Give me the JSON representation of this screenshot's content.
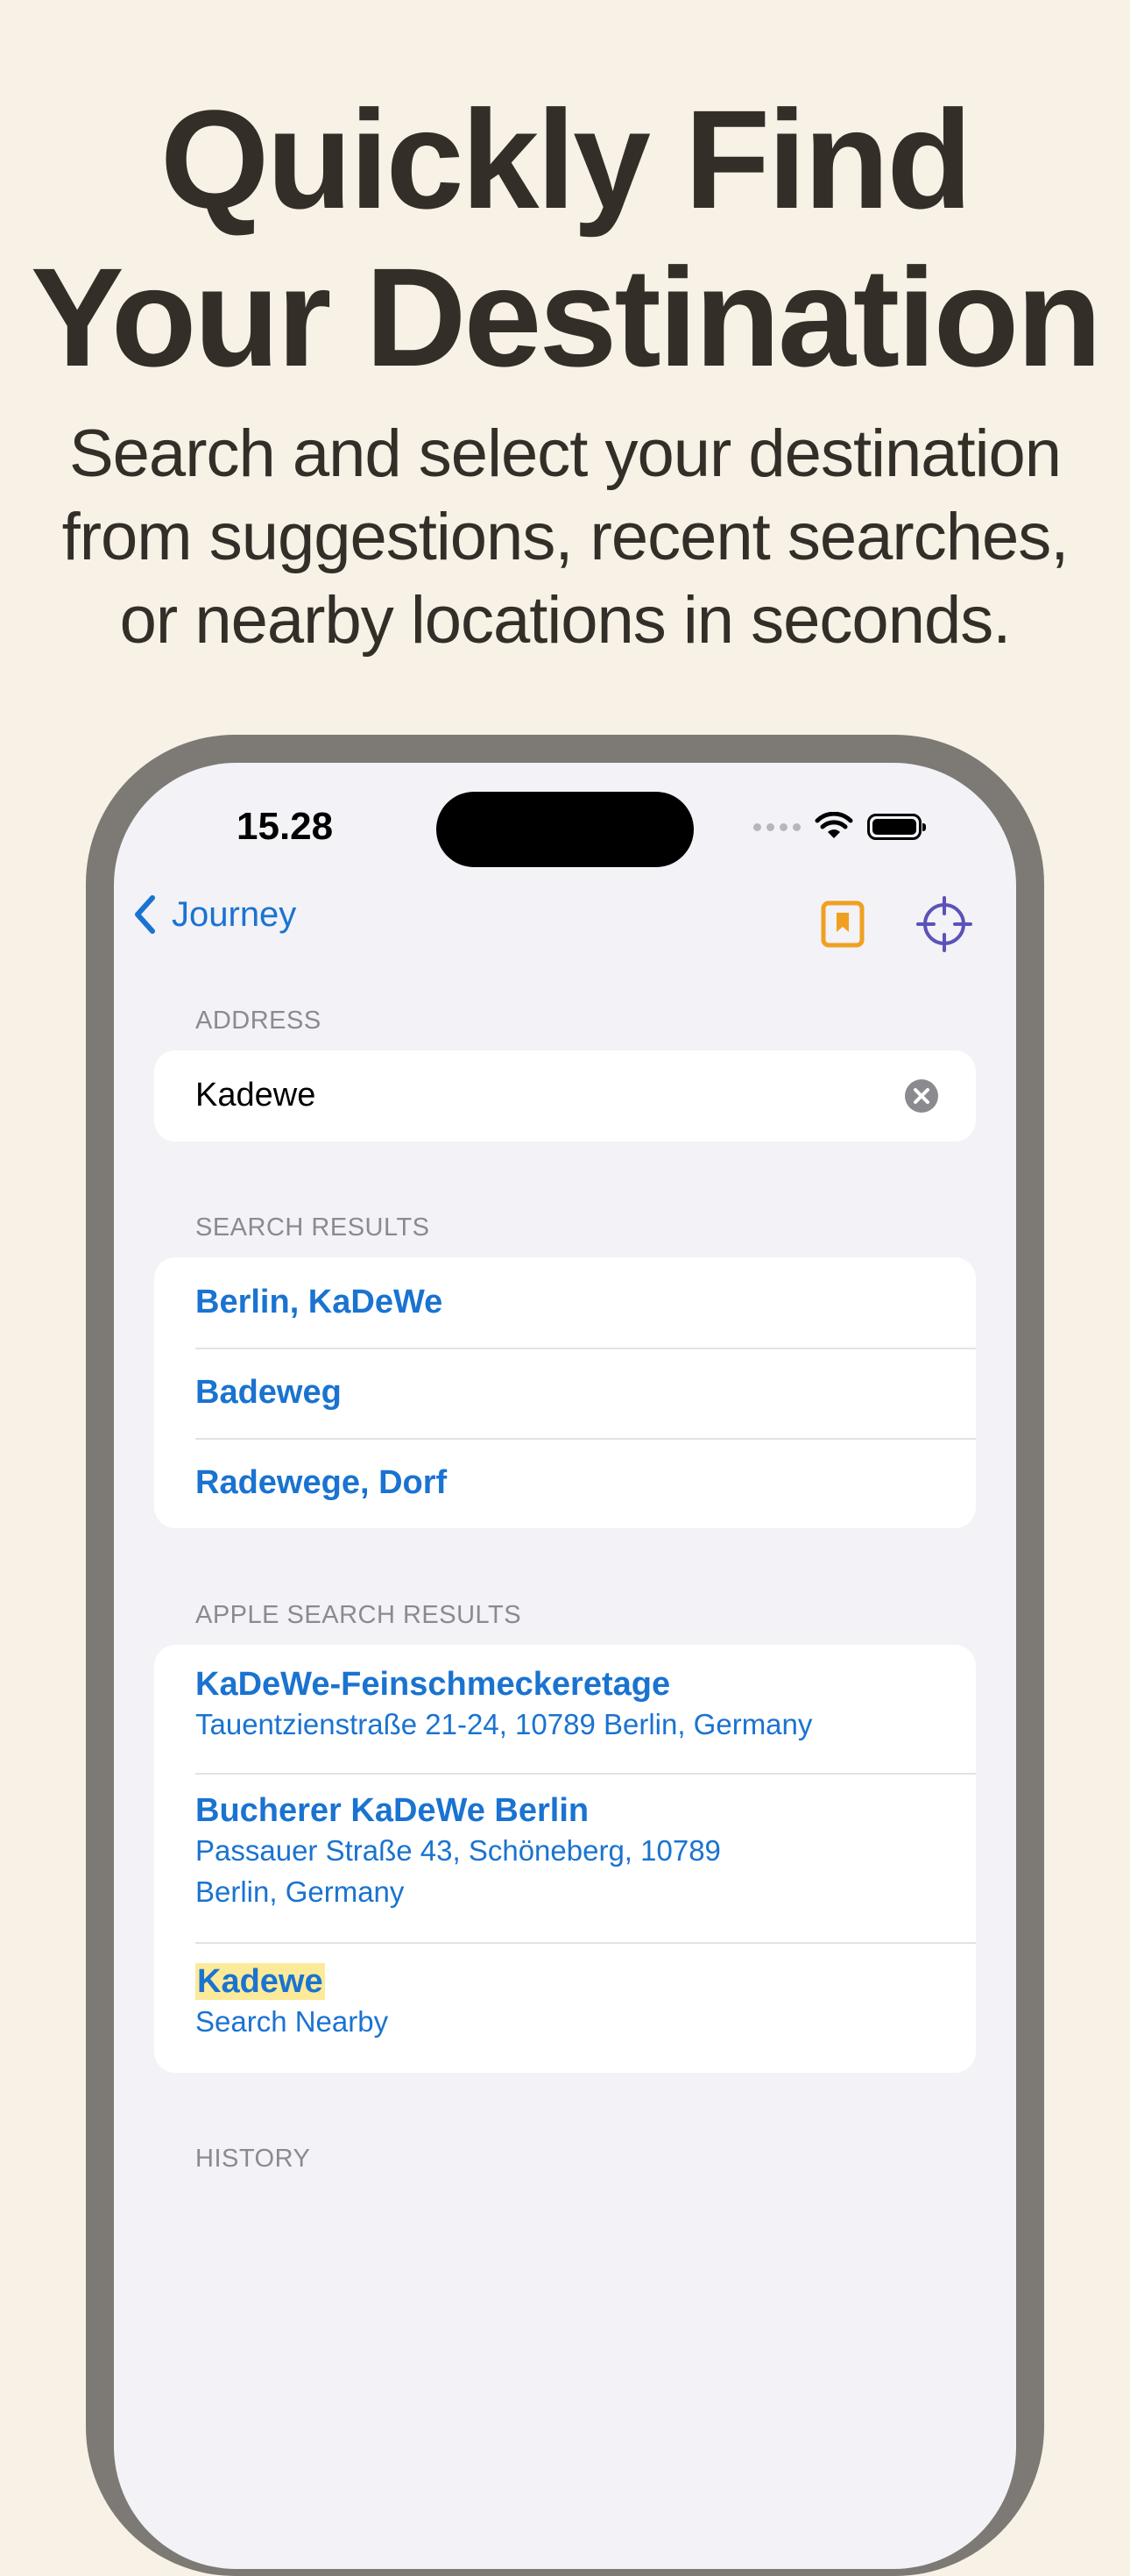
{
  "promo": {
    "headline_line1": "Quickly Find",
    "headline_line2": "Your Destination",
    "subhead_line1": "Search and select your destination",
    "subhead_line2": "from suggestions, recent searches,",
    "subhead_line3": "or nearby locations in seconds."
  },
  "status_bar": {
    "time": "15.28"
  },
  "nav": {
    "back_label": "Journey",
    "bookmark_icon": "bookmark-icon",
    "locate_icon": "crosshair-icon",
    "accent_color": "#1a73d0",
    "bookmark_color": "#f0a020"
  },
  "address": {
    "label": "ADDRESS",
    "value": "Kadewe"
  },
  "search_results": {
    "label": "SEARCH RESULTS",
    "items": [
      {
        "title": "Berlin, KaDeWe"
      },
      {
        "title": "Badeweg"
      },
      {
        "title": "Radewege, Dorf"
      }
    ]
  },
  "apple_results": {
    "label": "APPLE SEARCH RESULTS",
    "items": [
      {
        "title": "KaDeWe-Feinschmeckeretage",
        "subtitle_line1": "Tauentzienstraße 21-24, 10789 Berlin, Germany"
      },
      {
        "title": "Bucherer KaDeWe Berlin",
        "subtitle_line1": "Passauer Straße 43, Schöneberg, 10789",
        "subtitle_line2": "Berlin, Germany"
      },
      {
        "title": "Kadewe",
        "subtitle_line1": "Search Nearby"
      }
    ]
  },
  "history": {
    "label": "HISTORY"
  }
}
